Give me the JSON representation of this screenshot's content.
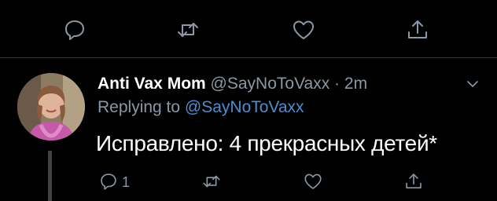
{
  "tweet": {
    "author_name": "Anti Vax Mom",
    "author_handle": "@SayNoToVaxx",
    "separator": "·",
    "timestamp": "2m",
    "replying_prefix": "Replying to",
    "replying_to": "@SayNoToVaxx",
    "text": "Исправлено: 4 прекрасных детей*",
    "reply_count": "1"
  },
  "icons": {
    "reply": "speech-bubble-icon",
    "retweet": "retweet-icon",
    "like": "heart-icon",
    "share": "share-upload-icon",
    "more": "chevron-down-icon"
  },
  "colors": {
    "background": "#000000",
    "text": "#ffffff",
    "muted": "#8b98a5",
    "link": "#4d8fd1",
    "divider": "#2f3336"
  }
}
